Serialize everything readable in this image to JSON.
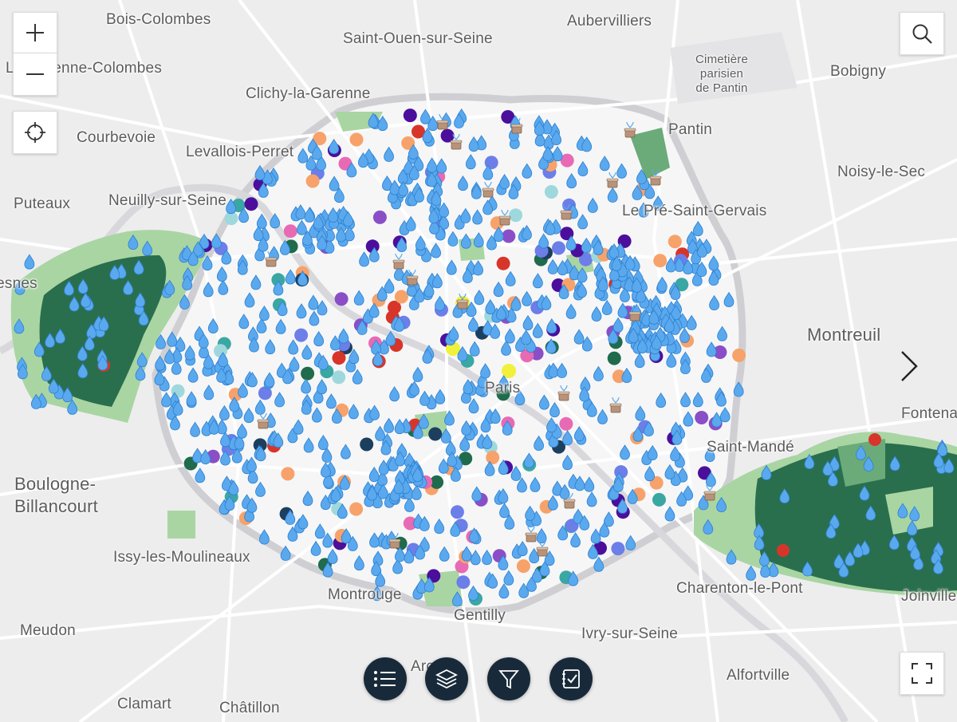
{
  "map": {
    "place_labels": {
      "bois_colombes": "Bois-Colombes",
      "saint_ouen": "Saint-Ouen-sur-Seine",
      "aubervilliers": "Aubervilliers",
      "cimetiere": [
        "Cimetière",
        "parisien",
        "de Pantin"
      ],
      "la_garenne_colombes": "La Garenne-Colombes",
      "bobigny": "Bobigny",
      "clichy": "Clichy-la-Garenne",
      "courbevoie": "Courbevoie",
      "levallois": "Levallois-Perret",
      "pantin": "Pantin",
      "noisy": "Noisy-le-Sec",
      "puteaux": "Puteaux",
      "neuilly": "Neuilly-sur-Seine",
      "pre_saint_gervais": "Le Pré-Saint-Gervais",
      "suresnes": "Suresnes",
      "montreuil": "Montreuil",
      "paris": "Paris",
      "fontenay": "Fontenay",
      "saint_mande": "Saint-Mandé",
      "boulogne": [
        "Boulogne-",
        "Billancourt"
      ],
      "issy": "Issy-les-Moulineaux",
      "montrouge": "Montrouge",
      "charenton": "Charenton-le-Pont",
      "gentilly": "Gentilly",
      "joinville": "Joinville-le",
      "meudon": "Meudon",
      "ivry": "Ivry-sur-Seine",
      "arcueil": "Arcueil",
      "alfortville": "Alfortville",
      "clamart": "Clamart",
      "chatillon": "Châtillon"
    },
    "marker_colors": {
      "water": "#5aa9ee",
      "orange": "#f7a26a",
      "purple": "#4b0f9c",
      "violet": "#8a4fc6",
      "dark_navy": "#1d3f5e",
      "pink": "#e86ab4",
      "dark_green": "#1f6b4c",
      "teal": "#3aa7a3",
      "red": "#d8352a",
      "yellow": "#f1f03a",
      "periwinkle": "#6c7ee8",
      "light_cyan": "#9fd8dc"
    },
    "park_colors": {
      "dark": "#2a6f4d",
      "light": "#a9d5a3",
      "mid": "#6bab7a"
    }
  },
  "controls": {
    "zoom_in_icon": "plus-icon",
    "zoom_out_icon": "minus-icon",
    "locate_icon": "crosshair-icon",
    "search_icon": "search-icon",
    "next_icon": "chevron-right-icon",
    "fullscreen_icon": "fullscreen-icon"
  },
  "toolbar": {
    "buttons": [
      "list-icon",
      "layers-icon",
      "filter-icon",
      "checklist-icon"
    ]
  }
}
